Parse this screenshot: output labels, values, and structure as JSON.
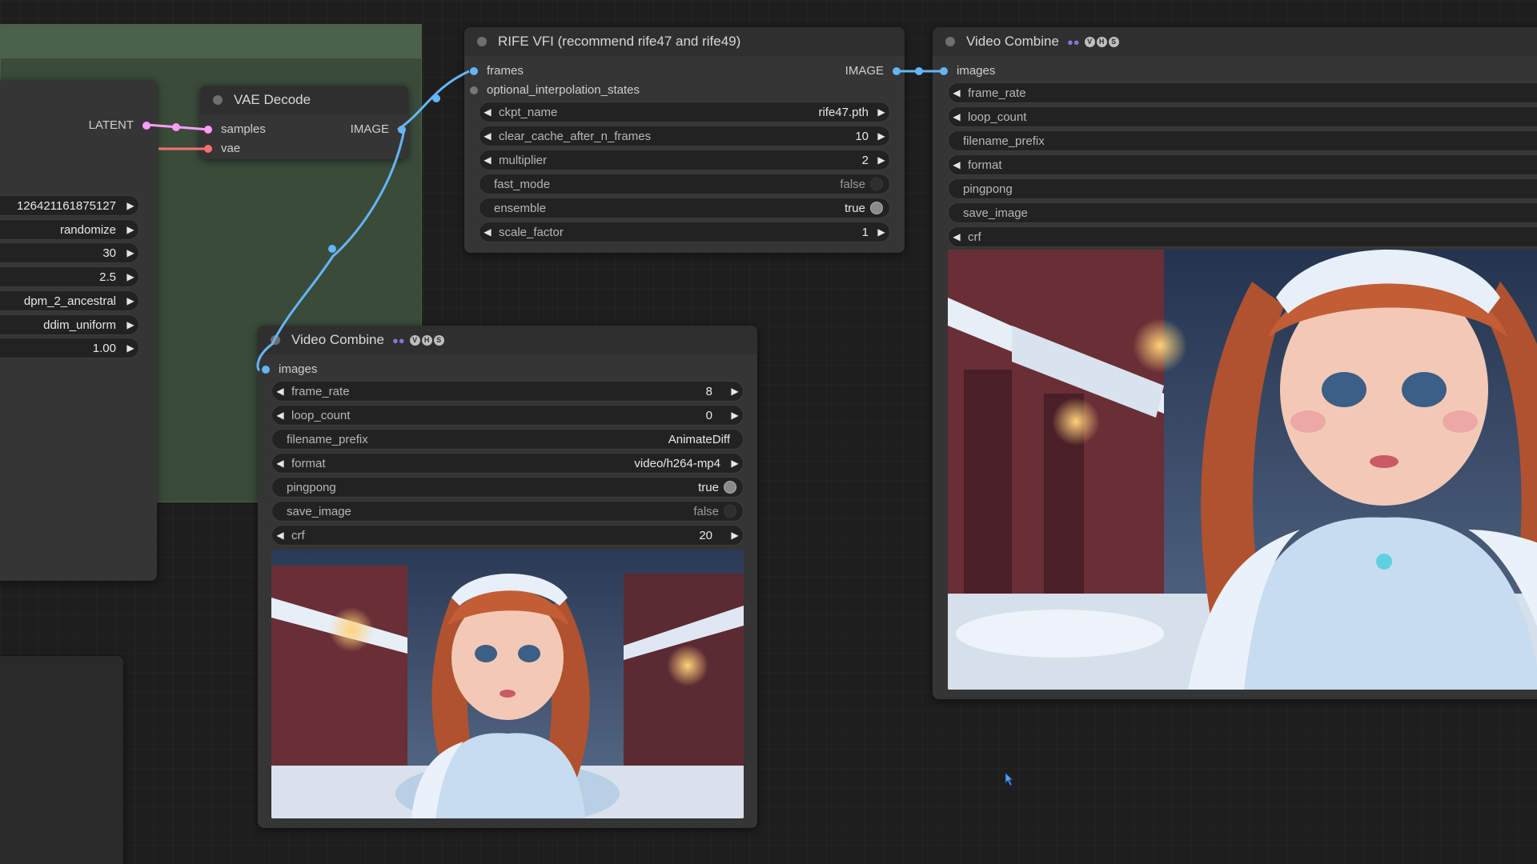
{
  "colors": {
    "latent": "#ff9cf9",
    "vae": "#ff6e6e",
    "image": "#64b5f6",
    "inactive": "#777777"
  },
  "left_node": {
    "output_label": "LATENT",
    "widgets": [
      {
        "value": "126421161875127"
      },
      {
        "value": "randomize"
      },
      {
        "value": "30"
      },
      {
        "value": "2.5"
      },
      {
        "value": "dpm_2_ancestral"
      },
      {
        "value": "ddim_uniform"
      },
      {
        "value": "1.00"
      }
    ]
  },
  "vae_decode": {
    "title": "VAE Decode",
    "inputs": [
      "samples",
      "vae"
    ],
    "output": "IMAGE"
  },
  "rife": {
    "title": "RIFE VFI (recommend rife47 and rife49)",
    "inputs": [
      "frames",
      "optional_interpolation_states"
    ],
    "output": "IMAGE",
    "widgets": [
      {
        "label": "ckpt_name",
        "value": "rife47.pth"
      },
      {
        "label": "clear_cache_after_n_frames",
        "value": "10"
      },
      {
        "label": "multiplier",
        "value": "2"
      },
      {
        "label": "fast_mode",
        "value": "false"
      },
      {
        "label": "ensemble",
        "value": "true"
      },
      {
        "label": "scale_factor",
        "value": "1"
      }
    ]
  },
  "video_combine_1": {
    "title": "Video Combine",
    "badge_icons": [
      "people-icon",
      "v-badge",
      "h-badge",
      "s-badge"
    ],
    "input": "images",
    "widgets": [
      {
        "label": "frame_rate",
        "value": "8"
      },
      {
        "label": "loop_count",
        "value": "0"
      },
      {
        "label": "filename_prefix",
        "value": "AnimateDiff"
      },
      {
        "label": "format",
        "value": "video/h264-mp4"
      },
      {
        "label": "pingpong",
        "value": "true"
      },
      {
        "label": "save_image",
        "value": "false"
      },
      {
        "label": "crf",
        "value": "20"
      }
    ]
  },
  "video_combine_2": {
    "title": "Video Combine",
    "badge_icons": [
      "people-icon",
      "v-badge",
      "h-badge",
      "s-badge"
    ],
    "input": "images",
    "widgets": [
      {
        "label": "frame_rate"
      },
      {
        "label": "loop_count"
      },
      {
        "label": "filename_prefix"
      },
      {
        "label": "format"
      },
      {
        "label": "pingpong"
      },
      {
        "label": "save_image"
      },
      {
        "label": "crf"
      }
    ]
  }
}
